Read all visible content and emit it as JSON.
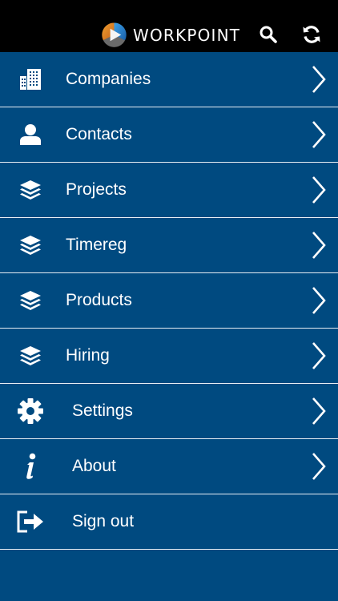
{
  "topbar": {
    "brand": "WORKPOINT",
    "icons": {
      "logo": "workpoint-logo",
      "search": "search-icon",
      "refresh": "refresh-icon"
    }
  },
  "menu": {
    "items": [
      {
        "label": "Companies",
        "icon": "building-icon"
      },
      {
        "label": "Contacts",
        "icon": "person-icon"
      },
      {
        "label": "Projects",
        "icon": "layers-icon"
      },
      {
        "label": "Timereg",
        "icon": "layers-icon"
      },
      {
        "label": "Products",
        "icon": "layers-icon"
      },
      {
        "label": "Hiring",
        "icon": "layers-icon"
      },
      {
        "label": "Settings",
        "icon": "gear-icon"
      },
      {
        "label": "About",
        "icon": "info-icon"
      },
      {
        "label": "Sign out",
        "icon": "sign-out-icon"
      }
    ]
  },
  "colors": {
    "background": "#004a80",
    "topbar": "#000000",
    "divider": "#e8eef4",
    "text": "#ffffff"
  }
}
